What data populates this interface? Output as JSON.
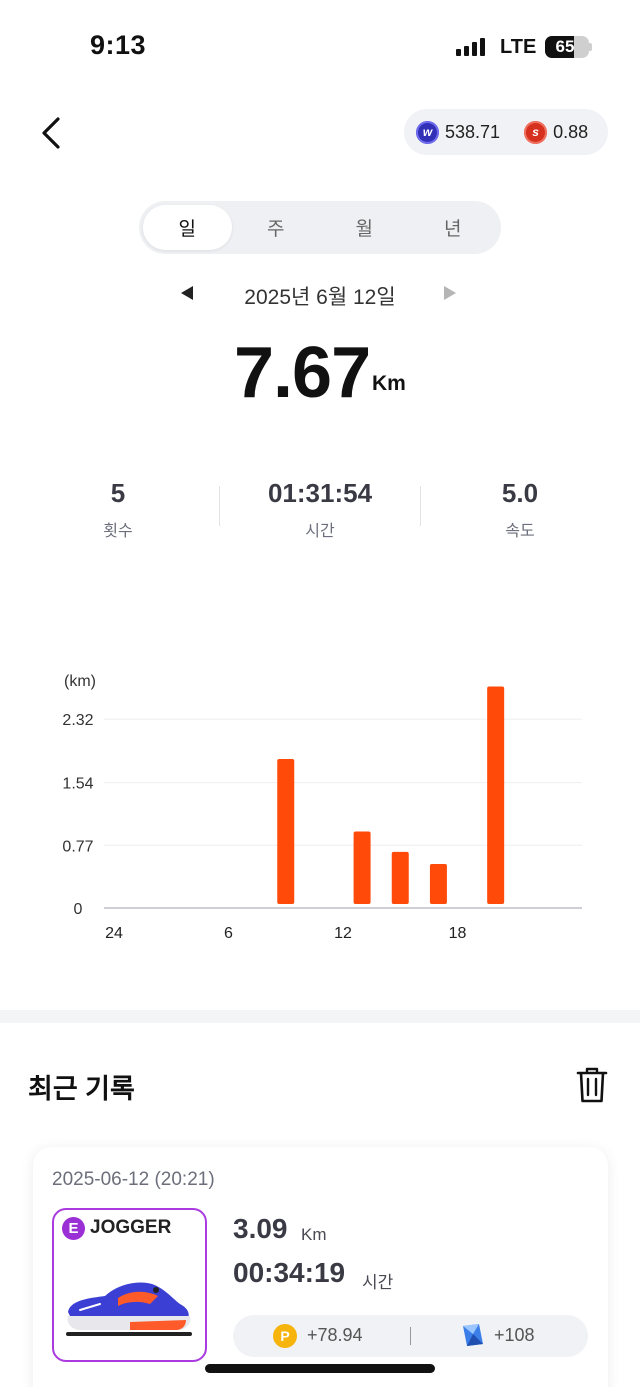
{
  "status_bar": {
    "time": "9:13",
    "network": "LTE",
    "battery": "65",
    "battery_level": 0.65
  },
  "balances": {
    "w_value": "538.71",
    "s_value": "0.88"
  },
  "tabs": [
    {
      "label": "일",
      "active": true
    },
    {
      "label": "주",
      "active": false
    },
    {
      "label": "월",
      "active": false
    },
    {
      "label": "년",
      "active": false
    }
  ],
  "date_nav": {
    "label": "2025년 6월 12일"
  },
  "summary": {
    "distance": "7.67",
    "unit": "Km"
  },
  "stats": {
    "count": {
      "value": "5",
      "label": "횟수"
    },
    "duration": {
      "value": "01:31:54",
      "label": "시간"
    },
    "speed": {
      "value": "5.0",
      "label": "속도"
    }
  },
  "chart_data": {
    "type": "bar",
    "ylabel": "(km)",
    "yticks": [
      0,
      0.77,
      1.54,
      2.32
    ],
    "ytick_labels": [
      "0",
      "0.77",
      "1.54",
      "2.32"
    ],
    "xticks": [
      0,
      6,
      12,
      18
    ],
    "xtick_labels": [
      "24",
      "6",
      "12",
      "18"
    ],
    "xlim": [
      0,
      24
    ],
    "ylim": [
      0,
      2.8
    ],
    "bar_color": "#ff4a0a",
    "bars": [
      {
        "hour": 9,
        "value": 1.83
      },
      {
        "hour": 13,
        "value": 0.94
      },
      {
        "hour": 15,
        "value": 0.69
      },
      {
        "hour": 17,
        "value": 0.54
      },
      {
        "hour": 20,
        "value": 2.72
      }
    ]
  },
  "recent": {
    "title": "최근 기록",
    "records": [
      {
        "datetime": "2025-06-12 (20:21)",
        "grade": "E",
        "shoe": "JOGGER",
        "distance": "3.09",
        "distance_unit": "Km",
        "duration": "00:34:19",
        "duration_unit": "시간",
        "points": "+78.94",
        "gems": "+108"
      }
    ]
  }
}
